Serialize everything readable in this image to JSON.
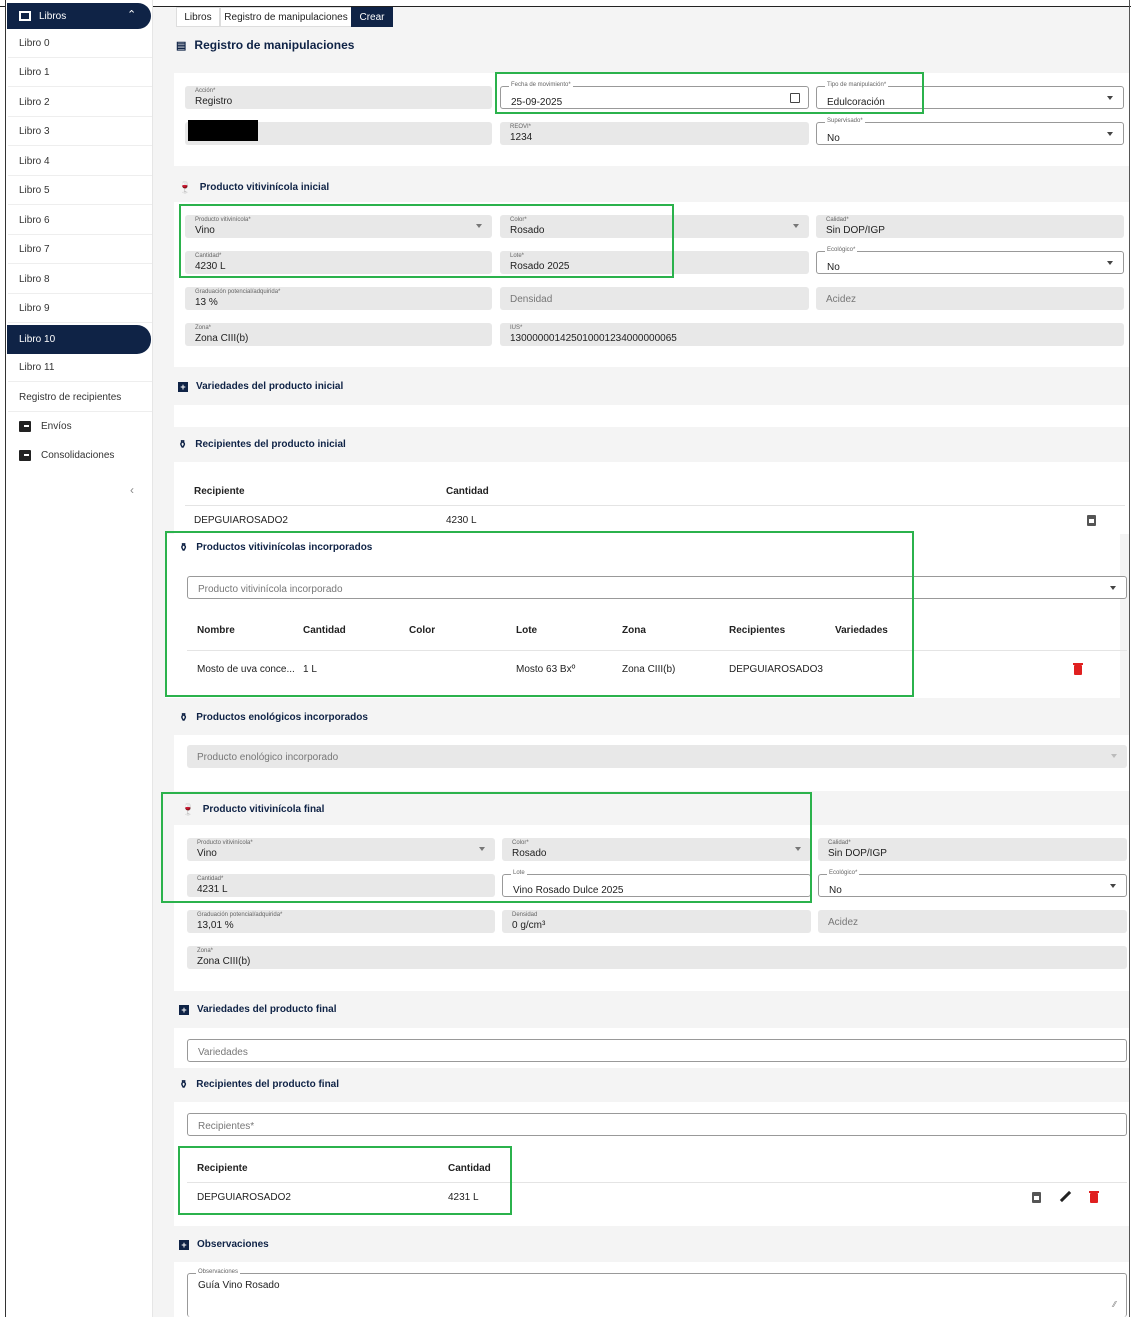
{
  "sidebar": {
    "header": "Libros",
    "items": [
      "Libro 0",
      "Libro 1",
      "Libro 2",
      "Libro 3",
      "Libro 4",
      "Libro 5",
      "Libro 6",
      "Libro 7",
      "Libro 8",
      "Libro 9",
      "Libro 10",
      "Libro 11",
      "Registro de recipientes",
      "Envíos",
      "Consolidaciones"
    ],
    "active": "Libro 10",
    "collapse": "‹"
  },
  "breadcrumb": [
    "Libros",
    "Registro de manipulaciones",
    "Crear"
  ],
  "page_title": "Registro de manipulaciones",
  "header_form": {
    "accion": {
      "label": "Acción*",
      "value": "Registro"
    },
    "fecha": {
      "label": "Fecha de movimiento*",
      "value": "25-09-2025"
    },
    "tipo": {
      "label": "Tipo de manipulación*",
      "value": "Edulcoración"
    },
    "reovi": {
      "label": "REOVI*",
      "value": "1234"
    },
    "supervisado": {
      "label": "Supervisado*",
      "value": "No"
    }
  },
  "inicial": {
    "title": "Producto vitivinícola inicial",
    "producto": {
      "label": "Producto vitivinícola*",
      "value": "Vino"
    },
    "color": {
      "label": "Color*",
      "value": "Rosado"
    },
    "calidad": {
      "label": "Calidad*",
      "value": "Sin DOP/IGP"
    },
    "cantidad": {
      "label": "Cantidad*",
      "value": "4230  L"
    },
    "lote": {
      "label": "Lote*",
      "value": "Rosado 2025"
    },
    "ecologico": {
      "label": "Ecológico*",
      "value": "No"
    },
    "graduacion": {
      "label": "Graduación potencial/adquirida*",
      "value": "13  %"
    },
    "densidad": "Densidad",
    "acidez": "Acidez",
    "zona": {
      "label": "Zona*",
      "value": "Zona CIII(b)"
    },
    "ius": {
      "label": "IUS*",
      "value": "130000001425010001234000000065"
    }
  },
  "variedades_inicial": "Variedades del producto inicial",
  "recipientes_inicial": {
    "title": "Recipientes del producto inicial",
    "headers": [
      "Recipiente",
      "Cantidad"
    ],
    "rows": [
      [
        "DEPGUIAROSADO2",
        "4230 L"
      ]
    ]
  },
  "incorporados": {
    "title": "Productos vitivinícolas incorporados",
    "placeholder": "Producto vitivinícola incorporado",
    "headers": [
      "Nombre",
      "Cantidad",
      "Color",
      "Lote",
      "Zona",
      "Recipientes",
      "Variedades"
    ],
    "rows": [
      [
        "Mosto de uva conce...",
        "1 L",
        "",
        "Mosto 63 Bxº",
        "Zona CIII(b)",
        "DEPGUIAROSADO3",
        ""
      ]
    ]
  },
  "enologicos": {
    "title": "Productos enológicos incorporados",
    "placeholder": "Producto enológico incorporado"
  },
  "final": {
    "title": "Producto vitivinícola final",
    "producto": {
      "label": "Producto vitivinícola*",
      "value": "Vino"
    },
    "color": {
      "label": "Color*",
      "value": "Rosado"
    },
    "calidad": {
      "label": "Calidad*",
      "value": "Sin DOP/IGP"
    },
    "cantidad": {
      "label": "Cantidad*",
      "value": "4231  L"
    },
    "lote": {
      "label": "Lote",
      "value": "Vino Rosado Dulce 2025"
    },
    "ecologico": {
      "label": "Ecológico*",
      "value": "No"
    },
    "graduacion": {
      "label": "Graduación potencial/adquirida*",
      "value": "13,01  %"
    },
    "densidad": {
      "label": "Densidad",
      "value": "0  g/cm³"
    },
    "acidez": "Acidez",
    "zona": {
      "label": "Zona*",
      "value": "Zona CIII(b)"
    }
  },
  "variedades_final": {
    "title": "Variedades del producto final",
    "placeholder": "Variedades"
  },
  "recipientes_final": {
    "title": "Recipientes del producto final",
    "placeholder": "Recipientes*",
    "headers": [
      "Recipiente",
      "Cantidad"
    ],
    "rows": [
      [
        "DEPGUIAROSADO2",
        "4231 L"
      ]
    ]
  },
  "observaciones": {
    "title": "Observaciones",
    "label": "Observaciones",
    "value": "Guía Vino Rosado"
  },
  "colors": {
    "navy": "#0f2346",
    "highlight": "#2bb24c",
    "danger": "#e02020"
  }
}
